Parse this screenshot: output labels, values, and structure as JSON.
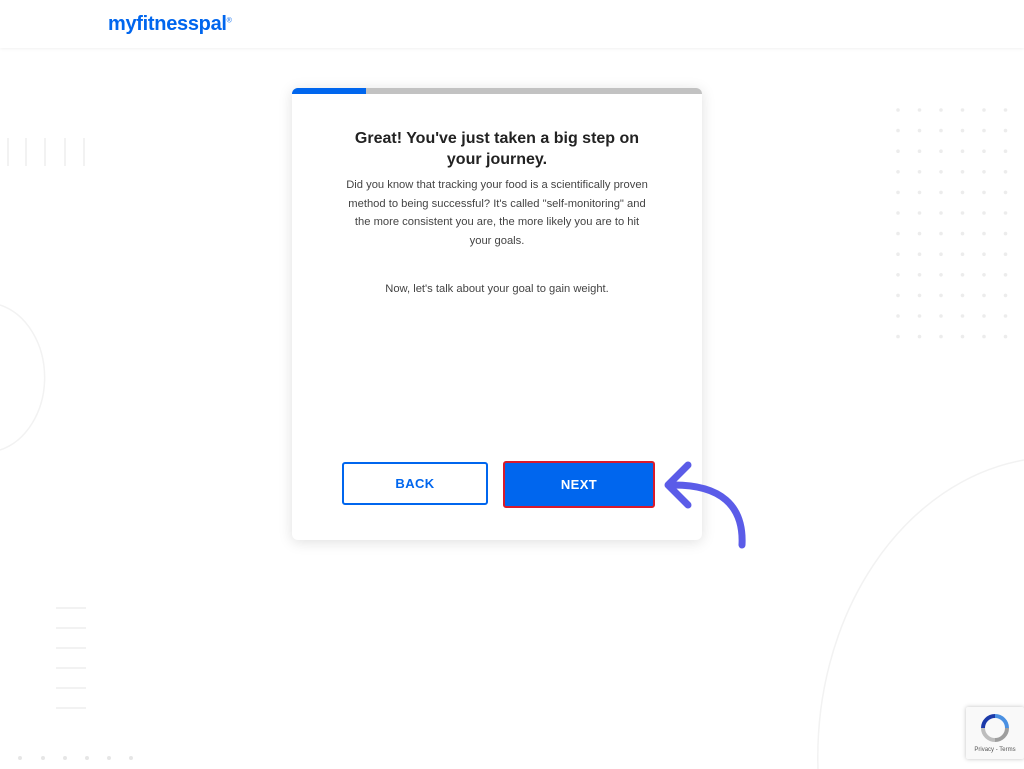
{
  "header": {
    "logo_text": "myfitnesspal",
    "logo_mark": "®"
  },
  "onboarding": {
    "progress": 0.18,
    "title_line1": "Great! You've just taken a big step on",
    "title_line2": "your journey.",
    "body_lines": [
      "Did you know that tracking your food is a scientifically proven",
      "method to being successful? It's called \"self-monitoring\" and",
      "the more consistent you are, the more likely you are to hit",
      "your goals."
    ],
    "sub_text": "Now, let's talk about your goal to gain weight.",
    "back_label": "BACK",
    "next_label": "NEXT"
  },
  "recaptcha": {
    "links": "Privacy - Terms"
  },
  "colors": {
    "brand": "#0066ee",
    "highlight": "#d81b2c",
    "arrow": "#5b5ce8"
  },
  "icons": [
    "curved-arrow-icon",
    "recaptcha-icon"
  ]
}
